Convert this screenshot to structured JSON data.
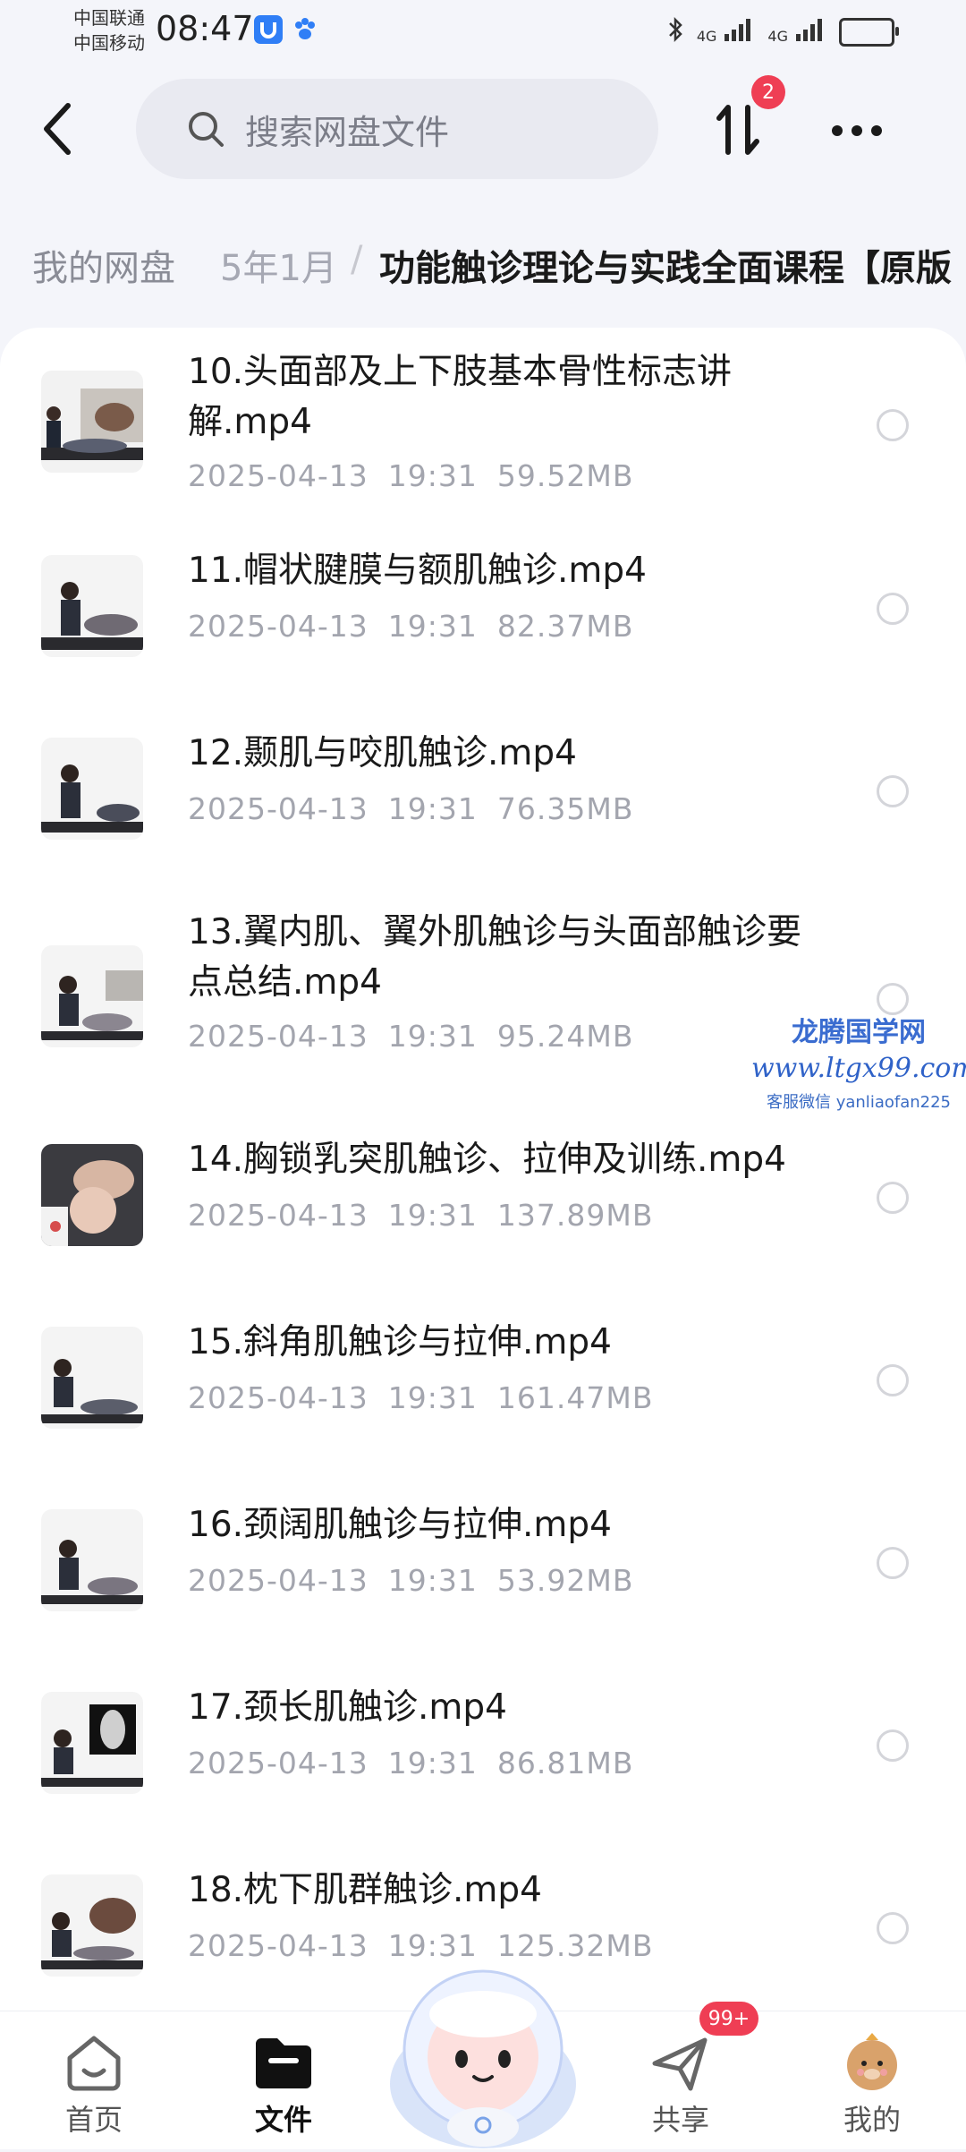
{
  "status_bar": {
    "carrier_1": "中国联通",
    "carrier_2": "中国移动",
    "time": "08:47",
    "signal_1": "4G",
    "signal_2": "4G"
  },
  "header": {
    "search_placeholder": "搜索网盘文件",
    "transfer_badge": "2"
  },
  "breadcrumb": {
    "home": "我的网盘",
    "middle": "5年1月",
    "separator": "/",
    "current": "功能触诊理论与实践全面课程【原版"
  },
  "files": [
    {
      "name": "10.头面部及上下肢基本骨性标志讲解.mp4",
      "date": "2025-04-13",
      "time": "19:31",
      "size": "59.52MB"
    },
    {
      "name": "11.帽状腱膜与额肌触诊.mp4",
      "date": "2025-04-13",
      "time": "19:31",
      "size": "82.37MB"
    },
    {
      "name": "12.颞肌与咬肌触诊.mp4",
      "date": "2025-04-13",
      "time": "19:31",
      "size": "76.35MB"
    },
    {
      "name": "13.翼内肌、翼外肌触诊与头面部触诊要点总结.mp4",
      "date": "2025-04-13",
      "time": "19:31",
      "size": "95.24MB"
    },
    {
      "name": "14.胸锁乳突肌触诊、拉伸及训练.mp4",
      "date": "2025-04-13",
      "time": "19:31",
      "size": "137.89MB"
    },
    {
      "name": "15.斜角肌触诊与拉伸.mp4",
      "date": "2025-04-13",
      "time": "19:31",
      "size": "161.47MB"
    },
    {
      "name": "16.颈阔肌触诊与拉伸.mp4",
      "date": "2025-04-13",
      "time": "19:31",
      "size": "53.92MB"
    },
    {
      "name": "17.颈长肌触诊.mp4",
      "date": "2025-04-13",
      "time": "19:31",
      "size": "86.81MB"
    },
    {
      "name": "18.枕下肌群触诊.mp4",
      "date": "2025-04-13",
      "time": "19:31",
      "size": "125.32MB"
    }
  ],
  "watermark": {
    "line1": "龙腾国学网",
    "line2": "www.ltgx99.com",
    "line3": "客服微信 yanliaofan225"
  },
  "tabbar": {
    "home": "首页",
    "files": "文件",
    "share": "共享",
    "share_badge": "99+",
    "mine": "我的"
  },
  "colors": {
    "accent_badge": "#ef3e54",
    "background": "#f4f5fa",
    "card": "#ffffff"
  }
}
